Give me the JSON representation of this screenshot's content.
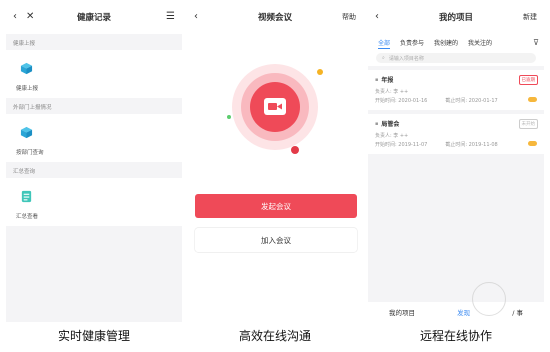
{
  "phone1": {
    "title": "健康记录",
    "sections": [
      {
        "label": "健康上报",
        "item": "健康上报",
        "icon": "cube-icon"
      },
      {
        "label": "外部门上报情况",
        "item": "按部门查询",
        "icon": "cube-icon"
      },
      {
        "label": "汇总查询",
        "item": "汇总查看",
        "icon": "document-icon"
      }
    ]
  },
  "phone2": {
    "title": "视频会议",
    "help": "帮助",
    "start_button": "发起会议",
    "join_button": "加入会议",
    "accent": "#ef4a58"
  },
  "phone3": {
    "title": "我的项目",
    "new_label": "新建",
    "tabs": [
      "全部",
      "负责参与",
      "我创建的",
      "我关注的"
    ],
    "search_placeholder": "请输入项目名称",
    "projects": [
      {
        "name": "年报",
        "owner": "负责人: 李 ++",
        "start": "开始时间: 2020-01-16",
        "end": "截止时间: 2020-01-17",
        "badge": "已逾期"
      },
      {
        "name": "局管会",
        "owner": "负责人: 李 ++",
        "start": "开始时间: 2019-11-07",
        "end": "截止时间: 2019-11-08",
        "badge": "未开始"
      }
    ],
    "bottom_nav": [
      "我的项目",
      "发现",
      "/ 事"
    ],
    "accent": "#3c8bf2"
  },
  "captions": [
    "实时健康管理",
    "高效在线沟通",
    "远程在线协作"
  ]
}
